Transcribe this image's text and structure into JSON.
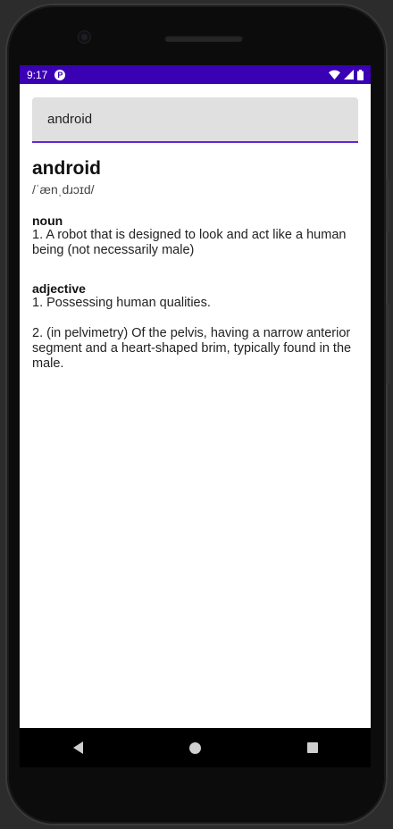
{
  "status_bar": {
    "time": "9:17",
    "notification_icon": "notification-icon",
    "icons": [
      "wifi-icon",
      "cell-signal-icon",
      "battery-icon"
    ]
  },
  "search": {
    "value": "android",
    "placeholder": ""
  },
  "entry": {
    "word": "android",
    "phonetic": "/ˈænˌdɹɔɪd/",
    "meanings": [
      {
        "part_of_speech": "noun",
        "definitions": [
          "1. A robot that is designed to look and act like a human being (not necessarily male)"
        ]
      },
      {
        "part_of_speech": "adjective",
        "definitions": [
          "1. Possessing human qualities.",
          "2. (in pelvimetry) Of the pelvis, having a narrow anterior segment and a heart-shaped brim, typically found in the male."
        ]
      }
    ]
  },
  "colors": {
    "status_bar": "#3a00b3",
    "accent": "#5f29d8",
    "search_bg": "#e0e0e0"
  }
}
